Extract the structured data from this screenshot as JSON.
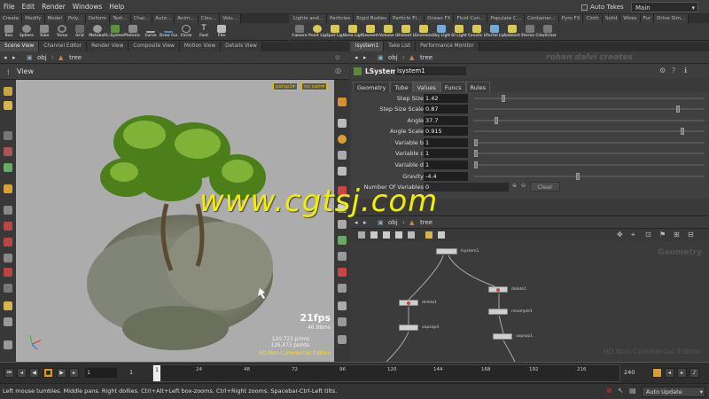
{
  "menu": {
    "items": [
      "File",
      "Edit",
      "Render",
      "Windows",
      "Help"
    ],
    "auto_takes": "Auto Takes",
    "desktop": "Main"
  },
  "shelf_tabs_left": [
    "Create",
    "Modify",
    "Model",
    "Poly...",
    "Deform",
    "Text...",
    "Char...",
    "Auto...",
    "Anim...",
    "Clou...",
    "Volu..."
  ],
  "shelf_tabs_right": [
    "Lights and...",
    "Particles",
    "Rigid Bodies",
    "Particle Fl...",
    "Ocean FX",
    "Fluid Con...",
    "Populate C...",
    "Container...",
    "Pyro FX",
    "Cloth",
    "Solid",
    "Wires",
    "Fur",
    "Drive Sim..."
  ],
  "shelf_tools_left": [
    "Box",
    "Sphere",
    "Tube",
    "Torus",
    "Grid",
    "Metaball",
    "L-System",
    "Platonic So...",
    "Curve",
    "Draw Curve",
    "Circle",
    "Font",
    "File"
  ],
  "shelf_tools_right": [
    "Camera",
    "Point Light",
    "Spot Light",
    "Area Light",
    "Geometry...",
    "Volume Li...",
    "Distant Light",
    "Environme...",
    "Sky Light",
    "GI Light",
    "Caustic Li...",
    "Portal Light",
    "Ambient Li...",
    "Stereo Ca...",
    "Switcher"
  ],
  "left_tabs": [
    "Scene View",
    "Channel Editor",
    "Render View",
    "Composite View",
    "Motion View",
    "Details View"
  ],
  "right_tabs": [
    "lsystem1",
    "Take List",
    "Performance Monitor"
  ],
  "left_path": {
    "root": "obj",
    "node": "tree"
  },
  "right_path": {
    "root": "obj",
    "node": "tree"
  },
  "viewport": {
    "title": "View",
    "camera": "persp1",
    "cam_menu": "no cam",
    "fps": "21fps",
    "ms": "46.98ms",
    "prims": "120,723  prims",
    "points": "126,473  points",
    "edition": "HD Non-Commercial Edition"
  },
  "params": {
    "node_type": "LSystem",
    "node_name": "lsystem1",
    "watermark_right": "rohan dalvi creates",
    "tabs": [
      "Geometry",
      "Tube",
      "Values",
      "Funcs",
      "Rules"
    ],
    "active_tab": "Values",
    "rows": [
      {
        "label": "Step Size",
        "value": "1.42",
        "knob": 0.12
      },
      {
        "label": "Step Size Scale",
        "value": "0.87",
        "knob": 0.89
      },
      {
        "label": "Angle",
        "value": "37.7",
        "knob": 0.09
      },
      {
        "label": "Angle Scale",
        "value": "0.915",
        "knob": 0.91
      },
      {
        "label": "Variable b",
        "value": "1",
        "knob": 0.0
      },
      {
        "label": "Variable c",
        "value": "1",
        "knob": 0.0
      },
      {
        "label": "Variable d",
        "value": "1",
        "knob": 0.0
      },
      {
        "label": "Gravity",
        "value": "-4.4",
        "knob": 0.45
      }
    ],
    "num_vars_label": "Number Of Variables",
    "num_vars_value": "0",
    "clear_label": "Clear"
  },
  "network": {
    "context": "Geometry",
    "edition": "HD Non-Commercial Edition",
    "nodes": [
      "lsystem1",
      "delete1",
      "delete1",
      "resample1",
      "vopsop4",
      "vopsop1"
    ]
  },
  "timeline": {
    "start": "1",
    "current": "1",
    "end": "240",
    "ticks": [
      "1",
      "24",
      "48",
      "72",
      "96",
      "120",
      "144",
      "168",
      "192",
      "216"
    ]
  },
  "status": {
    "message": "Left mouse tumbles. Middle pans. Right dollies. Ctrl+Alt+Left box-zooms. Ctrl+Right zooms. Spacebar-Ctrl-Left tilts.",
    "update_mode": "Auto Update"
  },
  "watermark": "www.cgtsj.com",
  "colors": {
    "accent": "#f3ee00",
    "viewport_bg": "#acacac",
    "panel": "#3a3a3a"
  }
}
